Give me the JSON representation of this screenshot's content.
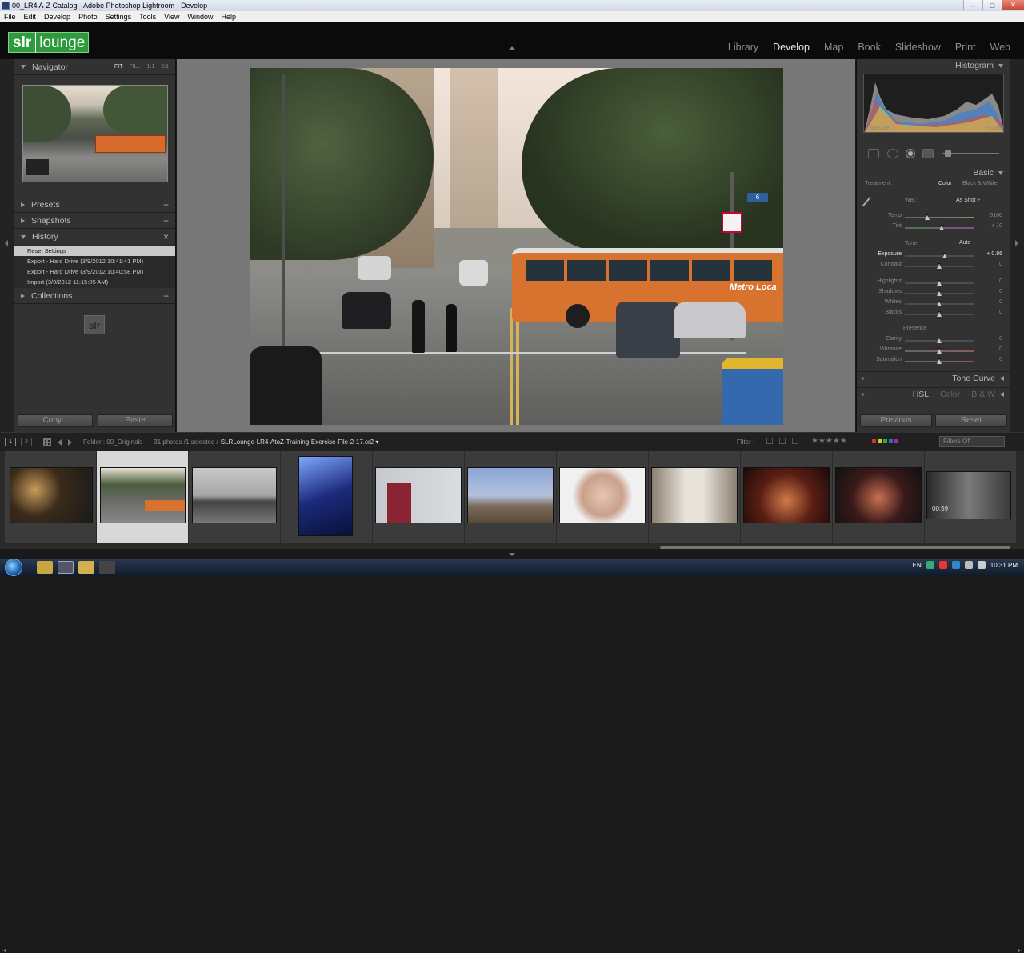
{
  "window": {
    "title": "00_LR4 A-Z Catalog - Adobe Photoshop Lightroom - Develop",
    "min": "–",
    "max": "□",
    "close": "✕"
  },
  "menu": [
    "File",
    "Edit",
    "Develop",
    "Photo",
    "Settings",
    "Tools",
    "View",
    "Window",
    "Help"
  ],
  "logo": {
    "part1": "slr",
    "part2": "lounge"
  },
  "modules": [
    {
      "label": "Library",
      "active": false
    },
    {
      "label": "Develop",
      "active": true
    },
    {
      "label": "Map",
      "active": false
    },
    {
      "label": "Book",
      "active": false
    },
    {
      "label": "Slideshow",
      "active": false
    },
    {
      "label": "Print",
      "active": false
    },
    {
      "label": "Web",
      "active": false
    }
  ],
  "left": {
    "navigator": {
      "label": "Navigator",
      "modes": [
        "FIT",
        "FILL",
        "1:1",
        "3:1"
      ]
    },
    "presets": {
      "label": "Presets",
      "plus": "+"
    },
    "snapshots": {
      "label": "Snapshots",
      "plus": "+"
    },
    "history": {
      "label": "History",
      "close": "×",
      "items": [
        "Reset Settings",
        "Export - Hard Drive (3/9/2012 10:41:41 PM)",
        "Export - Hard Drive (3/9/2012 10:40:58 PM)",
        "Import (3/9/2012 11:15:05 AM)"
      ]
    },
    "collections": {
      "label": "Collections",
      "plus": "+"
    },
    "watermark": "slr",
    "copy_label": "Copy...",
    "paste_label": "Paste"
  },
  "right": {
    "histogram": {
      "label": "Histogram",
      "footer_left": "Exposure",
      "footer_right": "+ 0.86"
    },
    "basic": {
      "label": "Basic",
      "treatment_label": "Treatment :",
      "treatment_color": "Color",
      "treatment_bw": "Black & White",
      "wb_label": "WB :",
      "wb_value": "As Shot ÷",
      "tone_label": "Tone",
      "auto_label": "Auto",
      "presence_label": "Presence",
      "sliders": [
        {
          "label": "Temp",
          "value": "5100"
        },
        {
          "label": "Tint",
          "value": "+ 10"
        },
        {
          "label": "Exposure",
          "value": "+ 0.86"
        },
        {
          "label": "Contrast",
          "value": "0"
        },
        {
          "label": "Highlights",
          "value": "0"
        },
        {
          "label": "Shadows",
          "value": "0"
        },
        {
          "label": "Whites",
          "value": "0"
        },
        {
          "label": "Blacks",
          "value": "0"
        },
        {
          "label": "Clarity",
          "value": "0"
        },
        {
          "label": "Vibrance",
          "value": "0"
        },
        {
          "label": "Saturation",
          "value": "0"
        }
      ]
    },
    "tone_curve": "Tone Curve",
    "hsl": {
      "a": "HSL",
      "b": "Color",
      "c": "B & W"
    },
    "previous_label": "Previous",
    "reset_label": "Reset"
  },
  "filmbar": {
    "page1": "1",
    "page2": "2",
    "folder": "Folder : 00_Originals",
    "count": "31 photos /1 selected /",
    "file": "SLRLounge-LR4-AtoZ-Training-Exercise-File-2-17.cr2 ▾",
    "filter": "Filter :",
    "stars": "★★★★★",
    "filters_off": "Filters Off"
  },
  "filmstrip": {
    "video_duration": "00:59"
  },
  "photo": {
    "bus_sign": "Metro Loca",
    "street_sign": "6"
  },
  "tray": {
    "lang": "EN",
    "time": "10:31 PM"
  },
  "colors": {
    "accent": "#2e9a3e",
    "panel": "#323232",
    "bus": "#d7732f"
  }
}
